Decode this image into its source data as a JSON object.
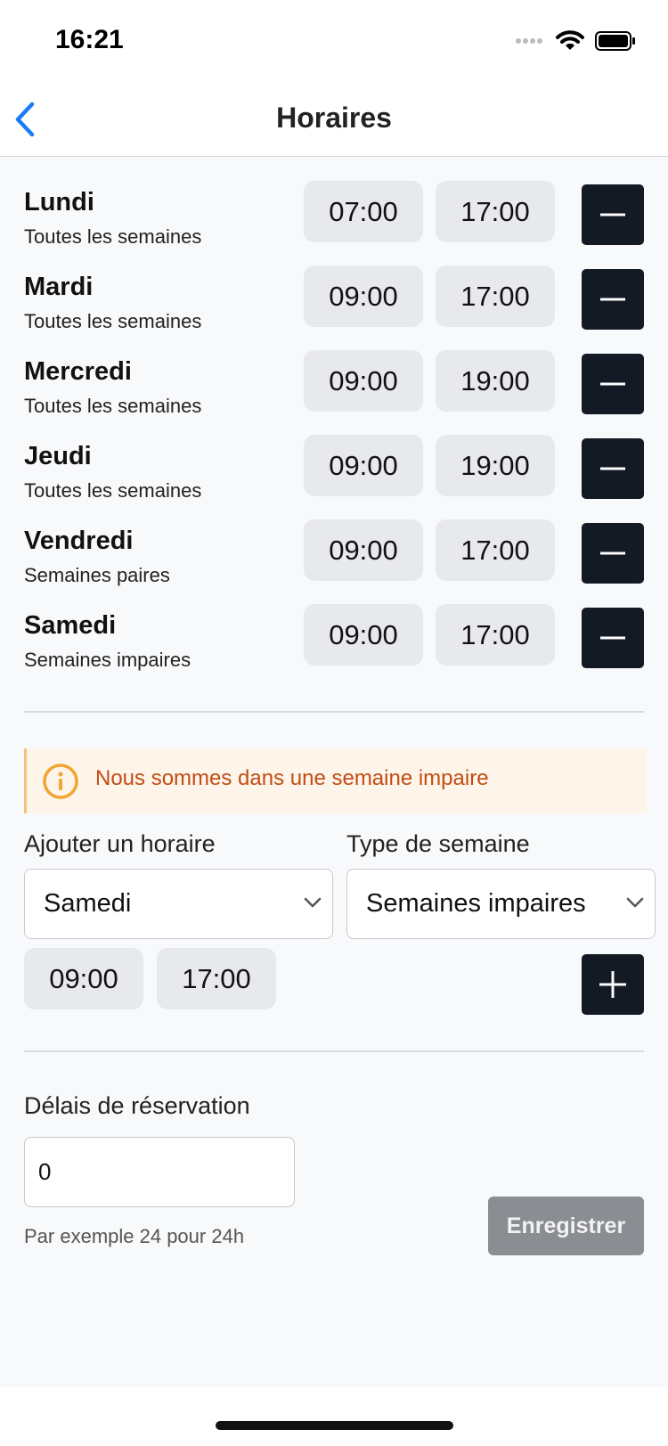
{
  "status": {
    "time": "16:21"
  },
  "nav": {
    "title": "Horaires",
    "back_icon": "chevron-left-icon",
    "accent": "#1a7cf5"
  },
  "schedule": [
    {
      "day": "Lundi",
      "week": "Toutes les semaines",
      "start": "07:00",
      "end": "17:00"
    },
    {
      "day": "Mardi",
      "week": "Toutes les semaines",
      "start": "09:00",
      "end": "17:00"
    },
    {
      "day": "Mercredi",
      "week": "Toutes les semaines",
      "start": "09:00",
      "end": "19:00"
    },
    {
      "day": "Jeudi",
      "week": "Toutes les semaines",
      "start": "09:00",
      "end": "19:00"
    },
    {
      "day": "Vendredi",
      "week": "Semaines paires",
      "start": "09:00",
      "end": "17:00"
    },
    {
      "day": "Samedi",
      "week": "Semaines impaires",
      "start": "09:00",
      "end": "17:00"
    }
  ],
  "alert": {
    "text": "Nous sommes dans une semaine impaire",
    "color": "#c24d14",
    "background": "#fdf4ea"
  },
  "add": {
    "day_label": "Ajouter un horaire",
    "week_label": "Type de semaine",
    "day_value": "Samedi",
    "week_value": "Semaines impaires",
    "start": "09:00",
    "end": "17:00"
  },
  "delay": {
    "label": "Délais de réservation",
    "value": "0",
    "hint": "Par exemple 24 pour 24h"
  },
  "save_label": "Enregistrer",
  "colors": {
    "dark_button": "#131a24",
    "pill": "#e8e9ec",
    "disabled_button": "#8a8d92"
  }
}
